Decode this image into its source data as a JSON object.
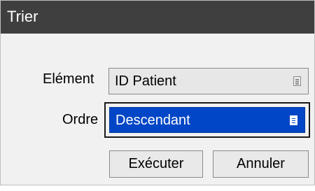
{
  "dialog": {
    "title": "Trier",
    "element": {
      "label": "Elément",
      "value": "ID Patient",
      "icon": "list-icon"
    },
    "order": {
      "label": "Ordre",
      "value": "Descendant",
      "icon": "list-icon",
      "state": "focused"
    },
    "buttons": {
      "execute": "Exécuter",
      "cancel": "Annuler"
    },
    "colors": {
      "titlebar": "#3f3f3f",
      "selection": "#0046c6",
      "background": "#f1f1f1"
    }
  }
}
